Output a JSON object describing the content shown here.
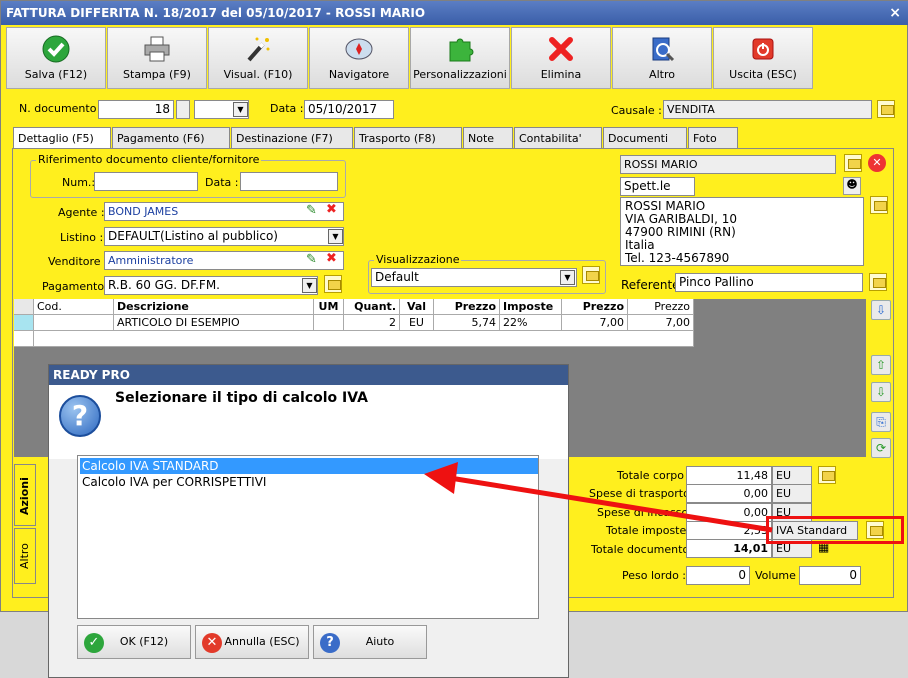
{
  "window": {
    "title": "FATTURA DIFFERITA N. 18/2017 del 05/10/2017 - ROSSI MARIO",
    "close": "×"
  },
  "toolbar": [
    {
      "label": "Salva (F12)",
      "icon": "check-icon"
    },
    {
      "label": "Stampa (F9)",
      "icon": "printer-icon"
    },
    {
      "label": "Visual. (F10)",
      "icon": "magic-wand-icon"
    },
    {
      "label": "Navigatore",
      "icon": "compass-icon"
    },
    {
      "label": "Personalizzazioni",
      "icon": "puzzle-icon"
    },
    {
      "label": "Elimina",
      "icon": "delete-x-icon"
    },
    {
      "label": "Altro",
      "icon": "book-icon"
    },
    {
      "label": "Uscita (ESC)",
      "icon": "power-icon"
    }
  ],
  "header": {
    "ndoc_label": "N. documento :",
    "ndoc_value": "18",
    "data_label": "Data :",
    "data_value": "05/10/2017",
    "causale_label": "Causale :",
    "causale_value": "VENDITA"
  },
  "tabs": [
    "Dettaglio (F5)",
    "Pagamento (F6)",
    "Destinazione (F7)",
    "Trasporto (F8)",
    "Note",
    "Contabilita'",
    "Documenti",
    "Foto"
  ],
  "ref": {
    "title": "Riferimento documento cliente/fornitore",
    "num_label": "Num.:",
    "data_label": "Data :"
  },
  "fields": {
    "agente_label": "Agente :",
    "agente_value": "BOND JAMES",
    "listino_label": "Listino :",
    "listino_value": "DEFAULT(Listino al pubblico)",
    "venditore_label": "Venditore :",
    "venditore_value": "Amministratore",
    "pagamento_label": "Pagamento :",
    "pagamento_value": "R.B. 60 GG. DF.FM.",
    "visual_title": "Visualizzazione",
    "visual_value": "Default"
  },
  "customer": {
    "name": "ROSSI MARIO",
    "salutation": "Spett.le",
    "address": [
      "ROSSI MARIO",
      "VIA GARIBALDI, 10",
      "47900 RIMINI (RN)",
      "Italia",
      "Tel. 123-4567890"
    ],
    "referente_label": "Referente",
    "referente_value": "Pinco Pallino"
  },
  "grid": {
    "headers": [
      "Cod.",
      "Descrizione",
      "UM",
      "Quant.",
      "Val",
      "Prezzo",
      "Imposte",
      "Prezzo",
      "Prezzo"
    ],
    "row": [
      "",
      "ARTICOLO DI ESEMPIO",
      "",
      "2",
      "EU",
      "5,74",
      "22%",
      "7,00",
      "7,00"
    ]
  },
  "totals": {
    "corpo_label": "Totale corpo :",
    "corpo_value": "11,48",
    "corpo_cur": "EU",
    "trasporto_label": "Spese di trasporto :",
    "trasporto_value": "0,00",
    "trasporto_cur": "EU",
    "incasso_label": "Spese di incasso :",
    "incasso_value": "0,00",
    "incasso_cur": "EU",
    "imposte_label": "Totale imposte :",
    "imposte_value": "2,53",
    "imposte_type": "IVA Standard",
    "documento_label": "Totale documento :",
    "documento_value": "14,01",
    "documento_cur": "EU",
    "peso_label": "Peso lordo :",
    "peso_value": "0",
    "volume_label": "Volume :",
    "volume_value": "0"
  },
  "sidetabs": {
    "azioni": "Azioni",
    "altro": "Altro"
  },
  "dialog": {
    "title": "READY PRO",
    "question": "Selezionare il tipo di calcolo IVA",
    "options": [
      "Calcolo IVA STANDARD",
      "Calcolo IVA per CORRISPETTIVI"
    ],
    "ok": "OK (F12)",
    "cancel": "Annulla (ESC)",
    "help": "Aiuto"
  },
  "colors": {
    "window_bg": "#ffef1e",
    "selection": "#3399ff",
    "annotation": "#ee1111"
  }
}
